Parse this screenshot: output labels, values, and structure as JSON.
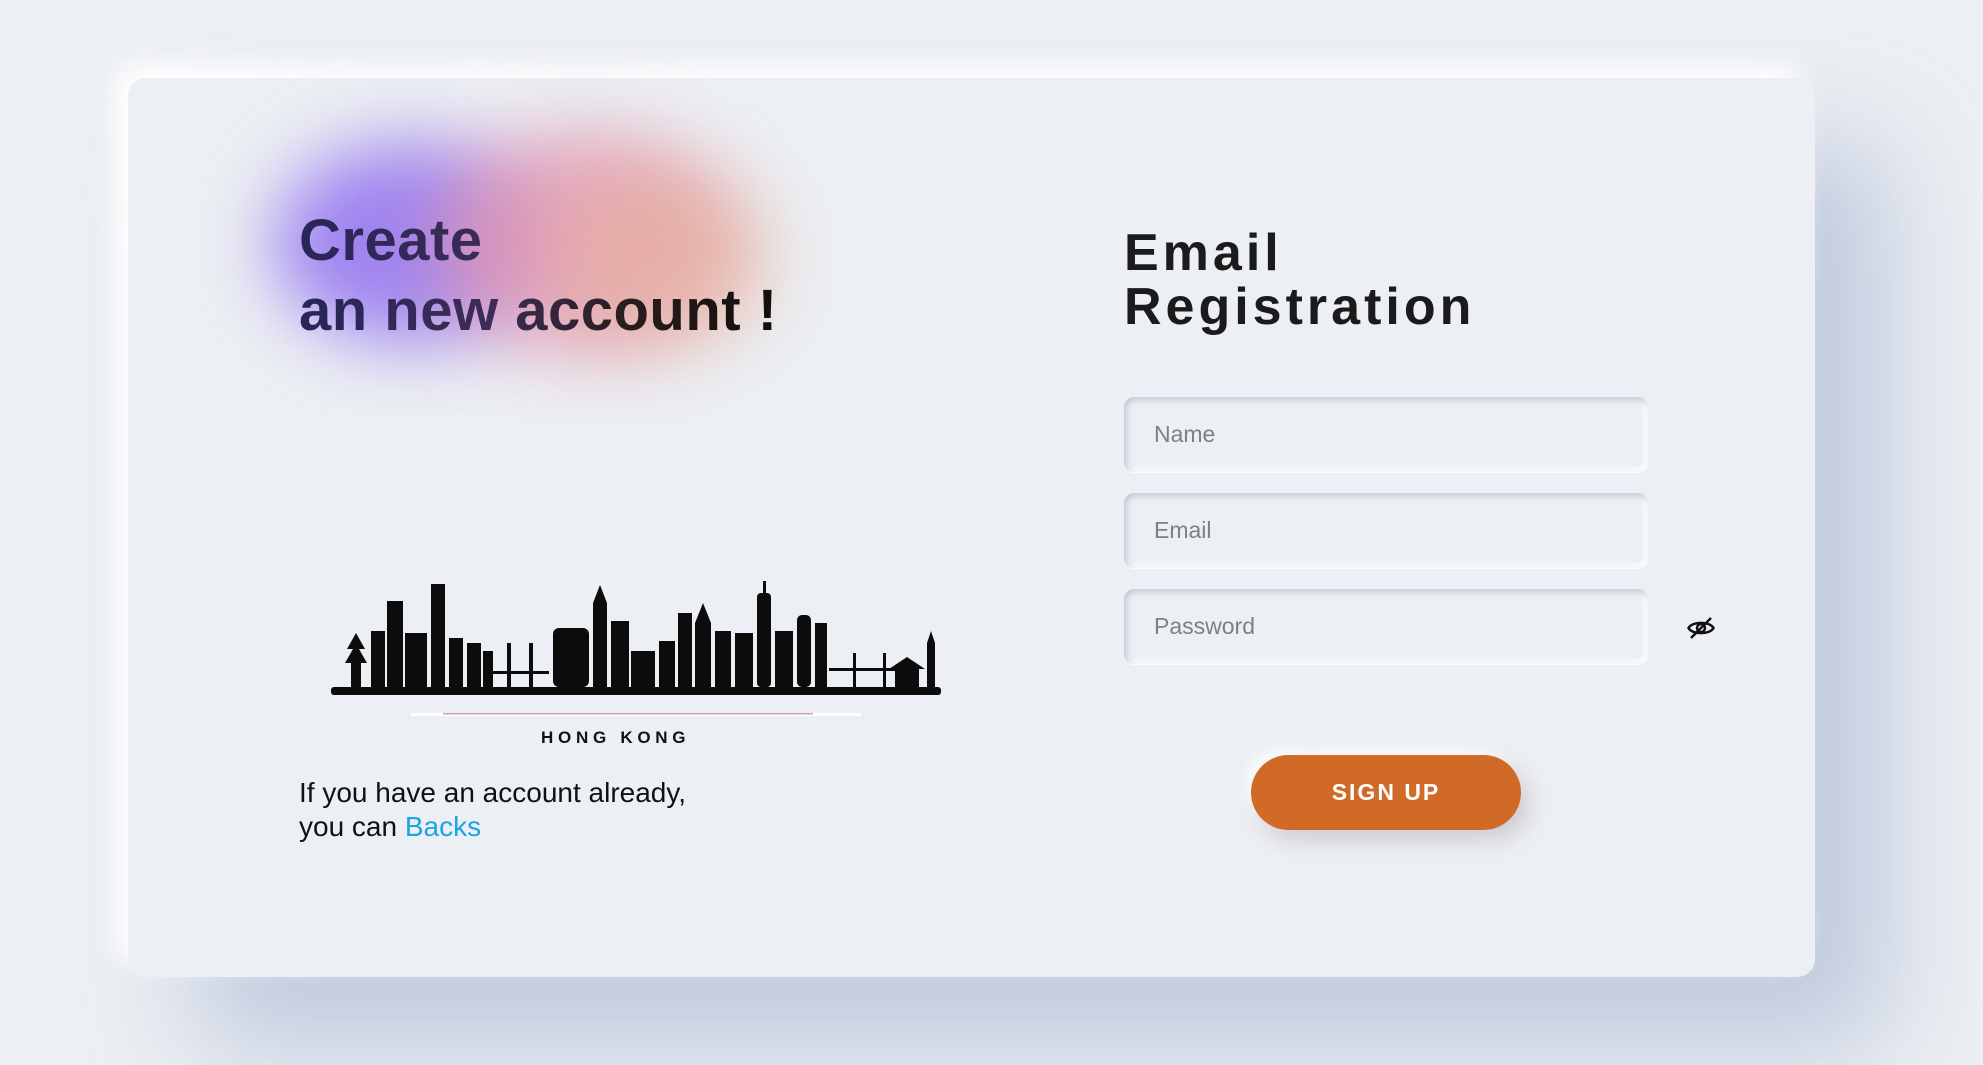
{
  "left_panel": {
    "title_line1": "Create",
    "title_line2": "an new account !",
    "skyline_caption": "H O N G   K O N G",
    "already_line1": "If you have an account already,",
    "already_line2_prefix": "you can ",
    "back_link_label": "Backs"
  },
  "form": {
    "title_line1": "Email",
    "title_line2": "Registration",
    "name_placeholder": "Name",
    "email_placeholder": "Email",
    "password_placeholder": "Password",
    "password_toggle_icon": "eye-slash-icon",
    "signup_label": "SIGN UP"
  },
  "colors": {
    "background": "#eceff3",
    "signup_button": "#d06a26",
    "link": "#1aa5e6",
    "blob_purple": "#9678f0",
    "blob_pink": "#e296af"
  }
}
